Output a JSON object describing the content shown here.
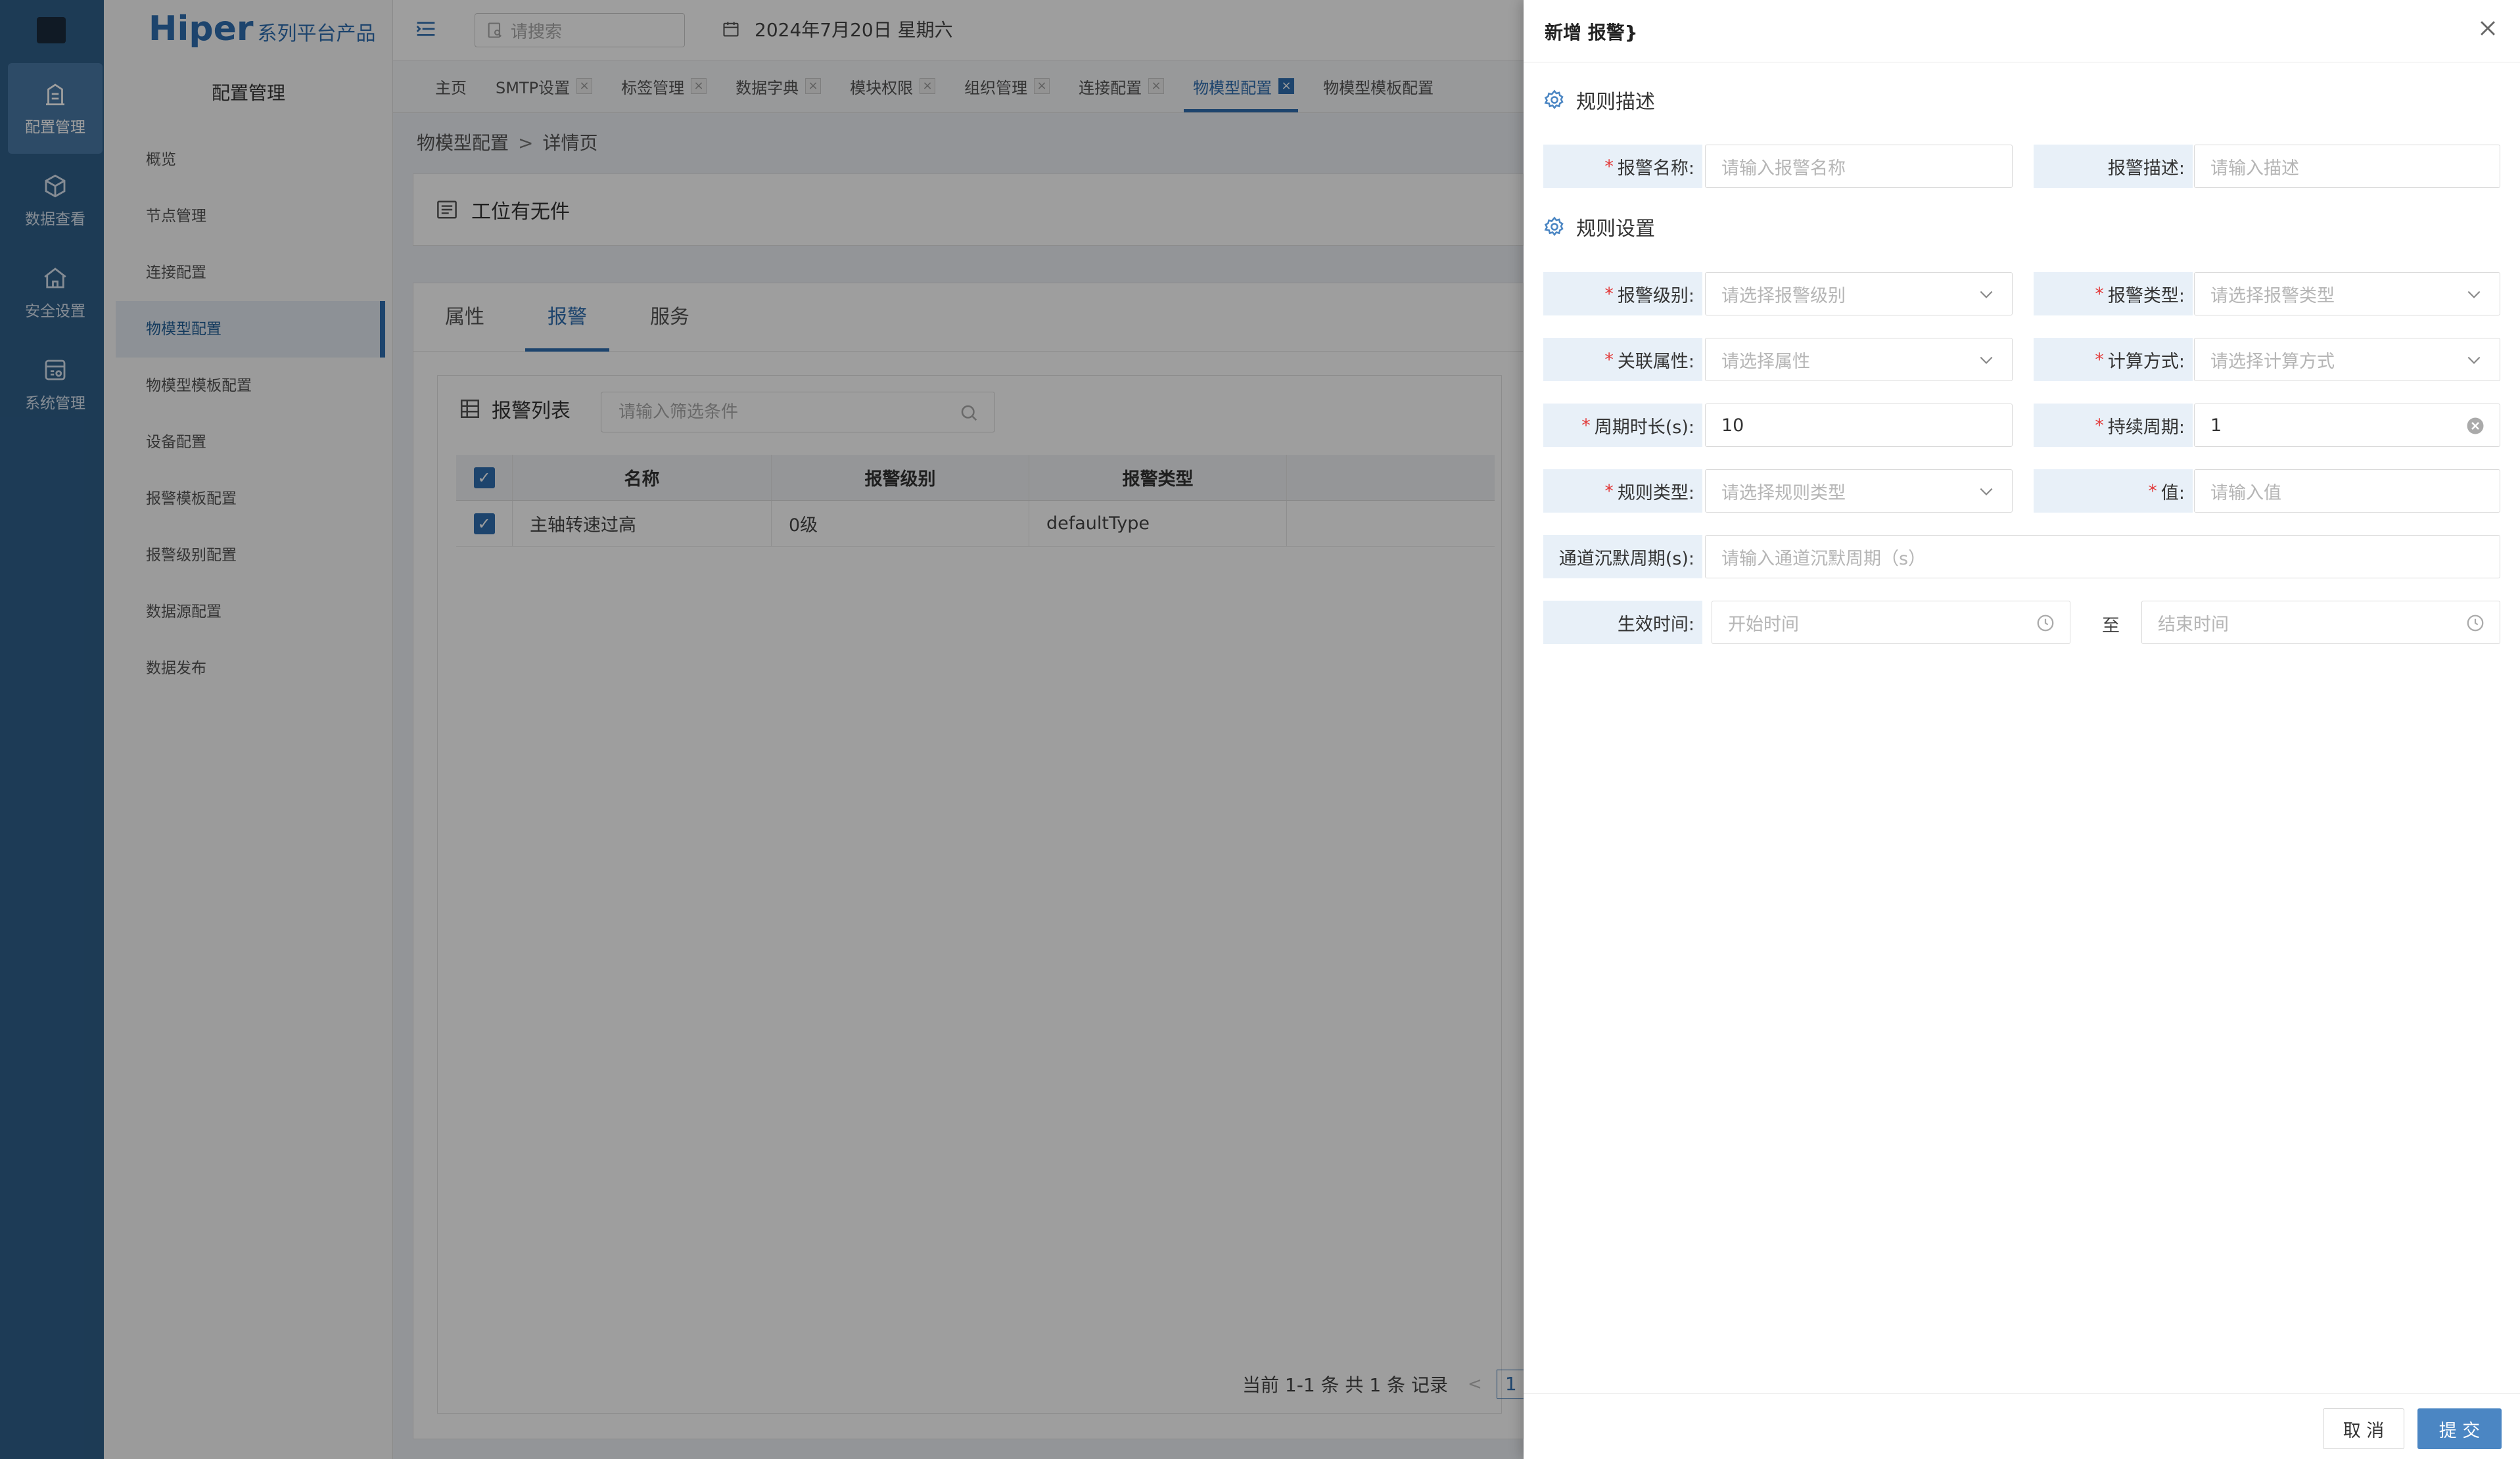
{
  "rail": {
    "items": [
      {
        "label": "配置管理"
      },
      {
        "label": "数据查看"
      },
      {
        "label": "安全设置"
      },
      {
        "label": "系统管理"
      }
    ]
  },
  "sidebar": {
    "brand_main": "Hiper",
    "brand_sub": "系列平台产品",
    "title": "配置管理",
    "items": [
      {
        "label": "概览"
      },
      {
        "label": "节点管理"
      },
      {
        "label": "连接配置"
      },
      {
        "label": "物模型配置"
      },
      {
        "label": "物模型模板配置"
      },
      {
        "label": "设备配置"
      },
      {
        "label": "报警模板配置"
      },
      {
        "label": "报警级别配置"
      },
      {
        "label": "数据源配置"
      },
      {
        "label": "数据发布"
      }
    ]
  },
  "header": {
    "search_placeholder": "请搜索",
    "date": "2024年7月20日 星期六"
  },
  "tabs": [
    {
      "label": "主页",
      "closable": false
    },
    {
      "label": "SMTP设置",
      "closable": true
    },
    {
      "label": "标签管理",
      "closable": true
    },
    {
      "label": "数据字典",
      "closable": true
    },
    {
      "label": "模块权限",
      "closable": true
    },
    {
      "label": "组织管理",
      "closable": true
    },
    {
      "label": "连接配置",
      "closable": true
    },
    {
      "label": "物模型配置",
      "closable": true
    },
    {
      "label": "物模型模板配置",
      "closable": false
    }
  ],
  "breadcrumb": {
    "parent": "物模型配置",
    "sep": ">",
    "current": "详情页"
  },
  "detail": {
    "title": "工位有无件",
    "subtabs": [
      "属性",
      "报警",
      "服务"
    ],
    "list_title": "报警列表",
    "filter_placeholder": "请输入筛选条件",
    "columns": [
      "名称",
      "报警级别",
      "报警类型"
    ],
    "rows": [
      {
        "name": "主轴转速过高",
        "level": "0级",
        "type": "defaultType"
      }
    ],
    "pager_text": "当前 1-1 条 共 1 条 记录",
    "page": "1"
  },
  "drawer": {
    "title": "新增 报警}",
    "sec1": "规则描述",
    "sec2": "规则设置",
    "f_name_label": "报警名称:",
    "f_name_ph": "请输入报警名称",
    "f_desc_label": "报警描述:",
    "f_desc_ph": "请输入描述",
    "f_level_label": "报警级别:",
    "f_level_ph": "请选择报警级别",
    "f_type_label": "报警类型:",
    "f_type_ph": "请选择报警类型",
    "f_attr_label": "关联属性:",
    "f_attr_ph": "请选择属性",
    "f_calc_label": "计算方式:",
    "f_calc_ph": "请选择计算方式",
    "f_period_label": "周期时长(s):",
    "f_period_val": "10",
    "f_dur_label": "持续周期:",
    "f_dur_val": "1",
    "f_rule_label": "规则类型:",
    "f_rule_ph": "请选择规则类型",
    "f_value_label": "值:",
    "f_value_ph": "请输入值",
    "f_silent_label": "通道沉默周期(s):",
    "f_silent_ph": "请输入通道沉默周期（s）",
    "f_time_label": "生效时间:",
    "f_start_ph": "开始时间",
    "f_to": "至",
    "f_end_ph": "结束时间",
    "cancel": "取 消",
    "submit": "提 交"
  }
}
